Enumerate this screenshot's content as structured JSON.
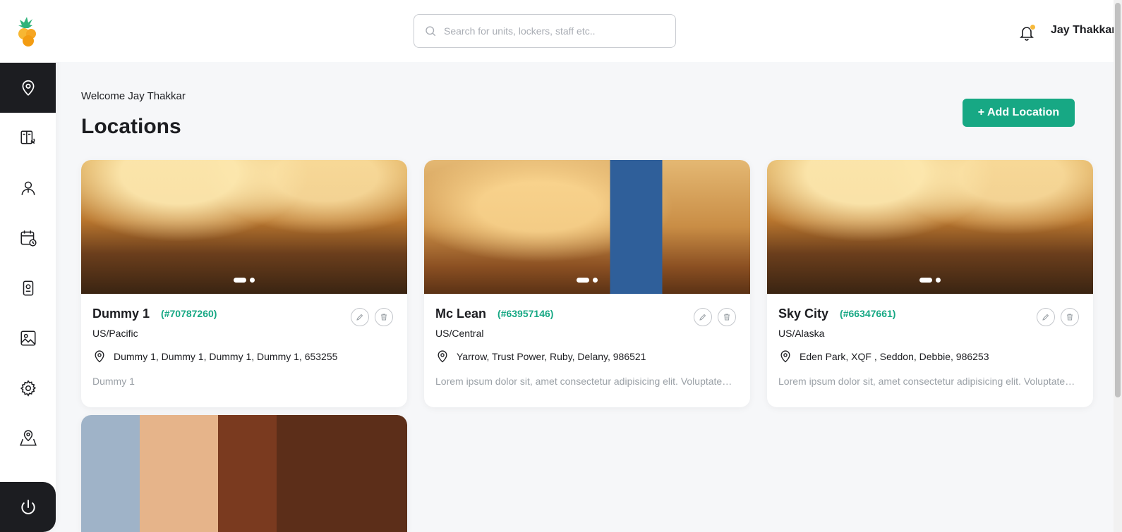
{
  "search": {
    "placeholder": "Search for units, lockers, staff etc.."
  },
  "header": {
    "user_name": "Jay Thakkar"
  },
  "sidebar": {
    "items": [
      {
        "name": "locations",
        "icon": "location-pin-icon",
        "active": true
      },
      {
        "name": "lockers",
        "icon": "locker-tools-icon",
        "active": false
      },
      {
        "name": "staff",
        "icon": "staff-icon",
        "active": false
      },
      {
        "name": "schedule",
        "icon": "calendar-clock-icon",
        "active": false
      },
      {
        "name": "devices",
        "icon": "device-icon",
        "active": false
      },
      {
        "name": "gallery",
        "icon": "image-icon",
        "active": false
      },
      {
        "name": "settings",
        "icon": "gear-icon",
        "active": false
      },
      {
        "name": "map",
        "icon": "map-pin-icon",
        "active": false
      }
    ],
    "logout_icon": "power-icon"
  },
  "main": {
    "welcome": "Welcome Jay Thakkar",
    "title": "Locations",
    "add_button": "+ Add Location"
  },
  "locations": [
    {
      "name": "Dummy 1",
      "id": "(#70787260)",
      "timezone": "US/Pacific",
      "address": "Dummy 1, Dummy 1, Dummy 1, Dummy 1, 653255",
      "description": "Dummy 1"
    },
    {
      "name": "Mc Lean",
      "id": "(#63957146)",
      "timezone": "US/Central",
      "address": "Yarrow, Trust Power, Ruby, Delany, 986521",
      "description": "Lorem ipsum dolor sit, amet consectetur adipisicing elit. Voluptatem, quibusdam."
    },
    {
      "name": "Sky City",
      "id": "(#66347661)",
      "timezone": "US/Alaska",
      "address": "Eden Park, XQF , Seddon, Debbie, 986253",
      "description": "Lorem ipsum dolor sit, amet consectetur adipisicing elit. Voluptatem, quibusdam."
    }
  ],
  "colors": {
    "accent": "#17a884",
    "dark": "#1c1d21",
    "notification": "#f6b93b"
  }
}
